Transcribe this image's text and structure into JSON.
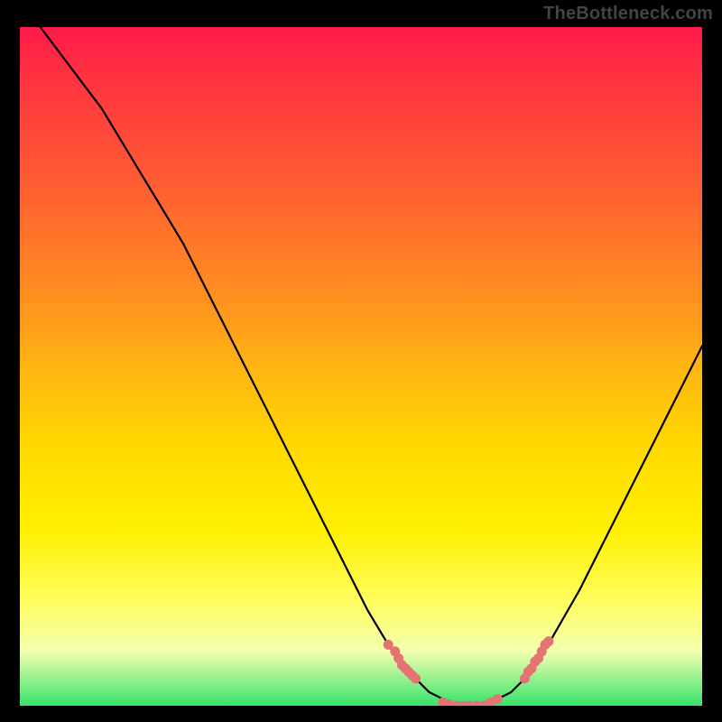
{
  "watermark": "TheBottleneck.com",
  "colors": {
    "page_bg": "#000000",
    "curve": "#000000",
    "dots": "#e57373",
    "gradient_start": "#ff1a4a",
    "gradient_end": "#37e36b"
  },
  "chart_data": {
    "type": "line",
    "title": "",
    "xlabel": "",
    "ylabel": "",
    "xlim": [
      0,
      100
    ],
    "ylim": [
      0,
      100
    ],
    "grid": false,
    "series": [
      {
        "name": "curve",
        "x": [
          3,
          6,
          9,
          12,
          15,
          18,
          21,
          24,
          27,
          30,
          33,
          36,
          39,
          42,
          45,
          48,
          51,
          54,
          56,
          58,
          60,
          62,
          64,
          66,
          68,
          70,
          72,
          75,
          78,
          82,
          86,
          90,
          94,
          98,
          100
        ],
        "y": [
          100,
          96,
          92,
          88,
          83,
          78,
          73,
          68,
          62,
          56,
          50,
          44,
          38,
          32,
          26,
          20,
          14,
          9,
          6,
          4,
          2,
          1,
          0,
          0,
          0,
          1,
          2,
          5,
          10,
          17,
          25,
          33,
          41,
          49,
          53
        ]
      }
    ],
    "dot_clusters": [
      {
        "name": "left-descent-dots",
        "points": [
          {
            "x": 54,
            "y": 9
          },
          {
            "x": 55,
            "y": 8
          },
          {
            "x": 55.5,
            "y": 7
          },
          {
            "x": 56,
            "y": 6
          },
          {
            "x": 56.5,
            "y": 5.5
          },
          {
            "x": 57,
            "y": 5
          },
          {
            "x": 57.5,
            "y": 4.5
          },
          {
            "x": 58,
            "y": 4
          }
        ]
      },
      {
        "name": "trough-dots",
        "points": [
          {
            "x": 62,
            "y": 0.5
          },
          {
            "x": 63,
            "y": 0.2
          },
          {
            "x": 64,
            "y": 0
          },
          {
            "x": 65,
            "y": 0
          },
          {
            "x": 66,
            "y": 0
          },
          {
            "x": 67,
            "y": 0
          },
          {
            "x": 68,
            "y": 0
          },
          {
            "x": 69,
            "y": 0.5
          },
          {
            "x": 70,
            "y": 1
          }
        ]
      },
      {
        "name": "right-ascent-dots",
        "points": [
          {
            "x": 74,
            "y": 4
          },
          {
            "x": 74.5,
            "y": 5
          },
          {
            "x": 75,
            "y": 5.5
          },
          {
            "x": 75.5,
            "y": 6.5
          },
          {
            "x": 76,
            "y": 7
          },
          {
            "x": 76.5,
            "y": 8
          },
          {
            "x": 77,
            "y": 9
          },
          {
            "x": 77.5,
            "y": 9.5
          }
        ]
      }
    ]
  }
}
